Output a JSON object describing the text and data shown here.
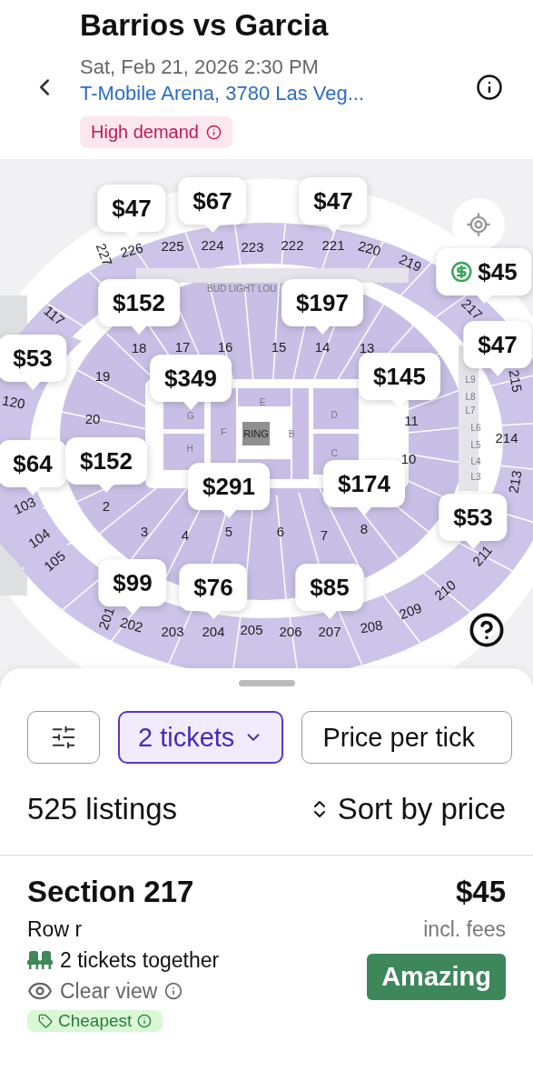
{
  "event": {
    "title": "Barrios vs Garcia",
    "date": "Sat, Feb 21, 2026 2:30 PM",
    "venue": "T-Mobile Arena, 3780 Las Veg...",
    "badge": "High demand"
  },
  "map": {
    "sections": [
      "227",
      "226",
      "225",
      "224",
      "223",
      "222",
      "221",
      "220",
      "219",
      "217",
      "117",
      "120",
      "103",
      "104",
      "105",
      "18",
      "17",
      "16",
      "15",
      "14",
      "13",
      "19",
      "20",
      "11",
      "10",
      "2",
      "3",
      "4",
      "5",
      "6",
      "7",
      "8",
      "214",
      "215",
      "213",
      "201",
      "202",
      "203",
      "204",
      "205",
      "206",
      "207",
      "208",
      "209",
      "210",
      "211",
      "L9",
      "L8",
      "L7",
      "L6",
      "L5",
      "L4",
      "L3"
    ],
    "floor": [
      "G",
      "H",
      "E",
      "F",
      "B",
      "D",
      "C"
    ],
    "ring": "RING",
    "lounge": "BUD LIGHT LOU",
    "pins": [
      {
        "price": "$47",
        "kind": "price"
      },
      {
        "price": "$67",
        "kind": "price"
      },
      {
        "price": "$47",
        "kind": "price"
      },
      {
        "price": "$45",
        "kind": "deal"
      },
      {
        "price": "$152",
        "kind": "price"
      },
      {
        "price": "$197",
        "kind": "price"
      },
      {
        "price": "$53",
        "kind": "price"
      },
      {
        "price": "$47",
        "kind": "price"
      },
      {
        "price": "$349",
        "kind": "price"
      },
      {
        "price": "$145",
        "kind": "price"
      },
      {
        "price": "$64",
        "kind": "price"
      },
      {
        "price": "$152",
        "kind": "price"
      },
      {
        "price": "$291",
        "kind": "price"
      },
      {
        "price": "$174",
        "kind": "price"
      },
      {
        "price": "$53",
        "kind": "price"
      },
      {
        "price": "$99",
        "kind": "price"
      },
      {
        "price": "$76",
        "kind": "price"
      },
      {
        "price": "$85",
        "kind": "price"
      }
    ]
  },
  "filters": {
    "quantity": "2 tickets",
    "quantity_active": true,
    "price_mode": "Price per tick"
  },
  "listings_count": "525 listings",
  "sort": "Sort by price",
  "listing": {
    "section": "Section 217",
    "price": "$45",
    "row": "Row r",
    "fees": "incl. fees",
    "seats": "2 tickets together",
    "view": "Clear view",
    "rating": "Amazing",
    "tag": "Cheapest"
  }
}
